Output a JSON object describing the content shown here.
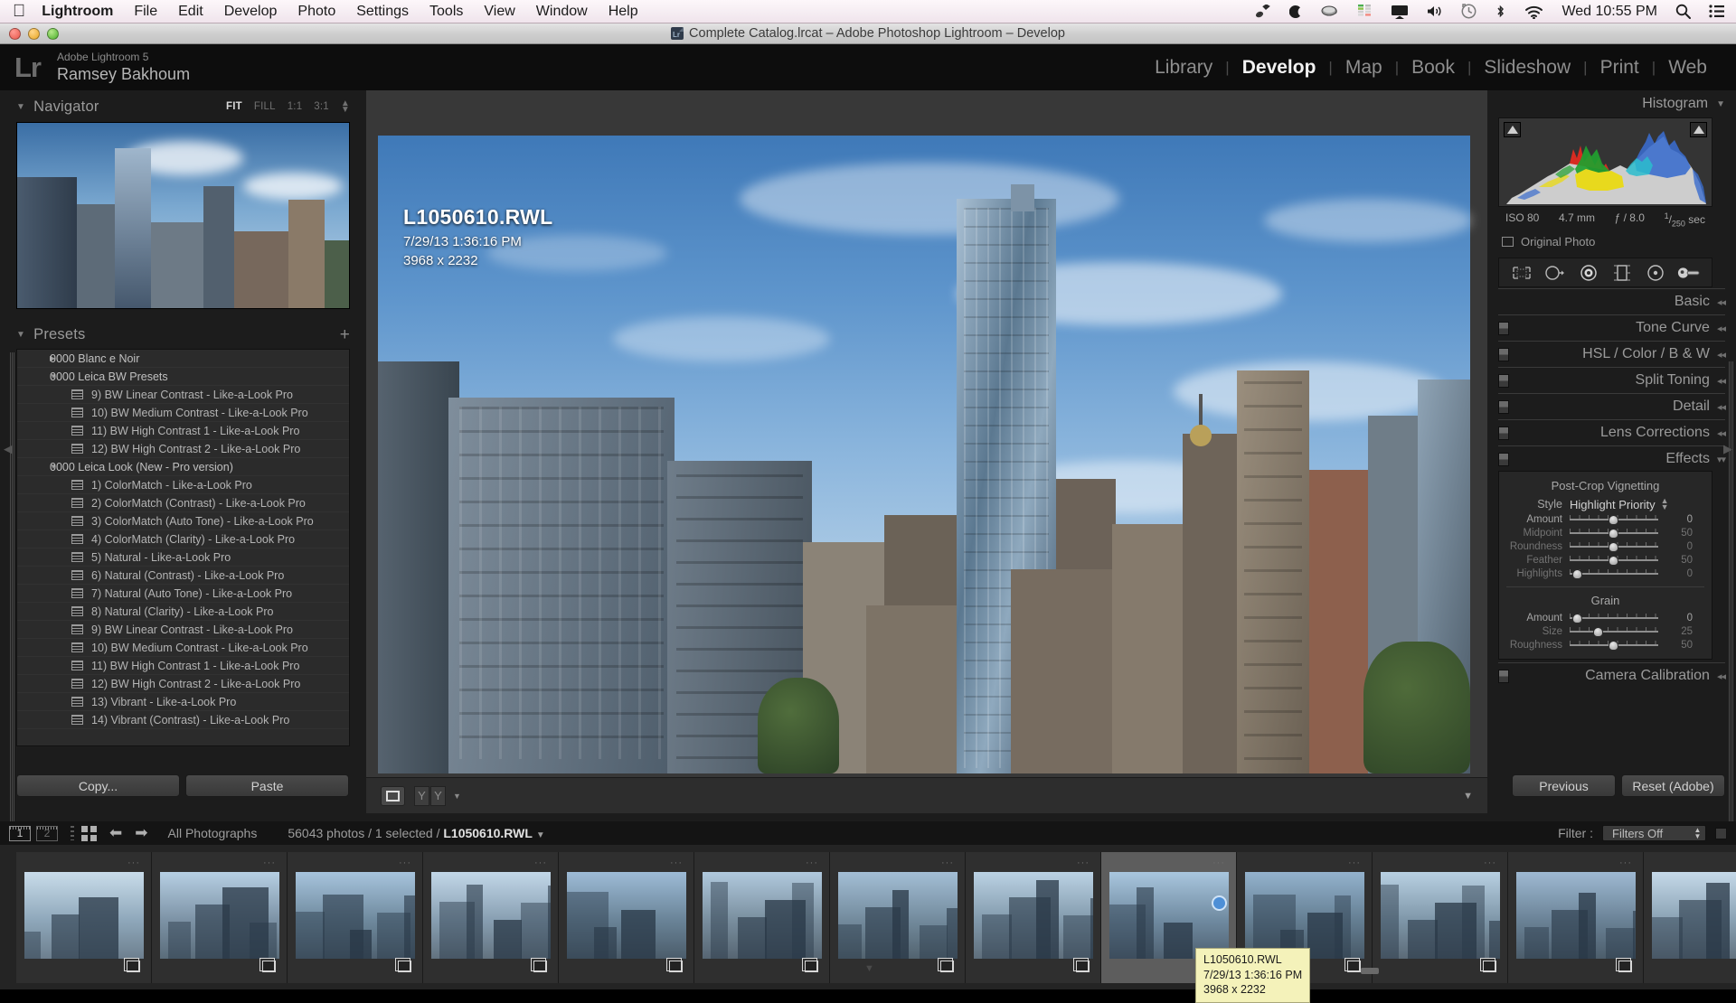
{
  "menubar": {
    "apple": "apple-logo",
    "items": [
      {
        "label": "Lightroom",
        "bold": true
      },
      {
        "label": "File",
        "bold": false
      },
      {
        "label": "Edit",
        "bold": false
      },
      {
        "label": "Develop",
        "bold": false
      },
      {
        "label": "Photo",
        "bold": false
      },
      {
        "label": "Settings",
        "bold": false
      },
      {
        "label": "Tools",
        "bold": false
      },
      {
        "label": "View",
        "bold": false
      },
      {
        "label": "Window",
        "bold": false
      },
      {
        "label": "Help",
        "bold": false
      }
    ],
    "status_icons": [
      "dropbox-icon",
      "moon-icon",
      "caffeine-cup-icon",
      "istat-menus-icon",
      "airplay-icon",
      "volume-icon",
      "time-machine-icon",
      "bluetooth-icon",
      "wifi-icon"
    ],
    "clock": "Wed 10:55 PM",
    "search_icon": "spotlight-search-icon",
    "notification_icon": "notification-center-icon"
  },
  "titlebar": {
    "title": "Complete Catalog.lrcat – Adobe Photoshop Lightroom – Develop",
    "doc_icon": "lightroom-catalog-icon"
  },
  "identity": {
    "mark": "Lr",
    "app_line": "Adobe Lightroom 5",
    "user_line": "Ramsey Bakhoum"
  },
  "modules": [
    {
      "label": "Library",
      "active": false
    },
    {
      "label": "Develop",
      "active": true
    },
    {
      "label": "Map",
      "active": false
    },
    {
      "label": "Book",
      "active": false
    },
    {
      "label": "Slideshow",
      "active": false
    },
    {
      "label": "Print",
      "active": false
    },
    {
      "label": "Web",
      "active": false
    }
  ],
  "navigator": {
    "title": "Navigator",
    "zoom_levels": [
      {
        "label": "FIT",
        "active": true
      },
      {
        "label": "FILL",
        "active": false
      },
      {
        "label": "1:1",
        "active": false
      },
      {
        "label": "3:1",
        "active": false
      }
    ],
    "stepper_icon": "zoom-stepper-icon"
  },
  "presets": {
    "title": "Presets",
    "add_icon": "plus-icon",
    "rows": [
      {
        "type": "group",
        "label": "0000 Blanc e Noir",
        "expanded": false
      },
      {
        "type": "group",
        "label": "0000 Leica BW Presets",
        "expanded": true
      },
      {
        "type": "item",
        "label": "9)  BW Linear Contrast - Like-a-Look Pro"
      },
      {
        "type": "item",
        "label": "10) BW Medium Contrast - Like-a-Look Pro"
      },
      {
        "type": "item",
        "label": "11) BW High Contrast 1 - Like-a-Look Pro"
      },
      {
        "type": "item",
        "label": "12) BW High Contrast 2 - Like-a-Look Pro"
      },
      {
        "type": "group",
        "label": "0000 Leica Look (New - Pro version)",
        "expanded": true
      },
      {
        "type": "item",
        "label": "1)  ColorMatch - Like-a-Look Pro"
      },
      {
        "type": "item",
        "label": "2)  ColorMatch (Contrast) - Like-a-Look Pro"
      },
      {
        "type": "item",
        "label": "3)  ColorMatch (Auto Tone) - Like-a-Look Pro"
      },
      {
        "type": "item",
        "label": "4)  ColorMatch (Clarity) - Like-a-Look Pro"
      },
      {
        "type": "item",
        "label": "5)  Natural - Like-a-Look Pro"
      },
      {
        "type": "item",
        "label": "6)  Natural (Contrast) - Like-a-Look Pro"
      },
      {
        "type": "item",
        "label": "7)  Natural (Auto Tone) - Like-a-Look Pro"
      },
      {
        "type": "item",
        "label": "8)  Natural (Clarity) - Like-a-Look Pro"
      },
      {
        "type": "item",
        "label": "9)  BW Linear Contrast - Like-a-Look Pro"
      },
      {
        "type": "item",
        "label": "10) BW Medium Contrast - Like-a-Look Pro"
      },
      {
        "type": "item",
        "label": "11) BW High Contrast 1 - Like-a-Look Pro"
      },
      {
        "type": "item",
        "label": "12) BW High Contrast 2 - Like-a-Look Pro"
      },
      {
        "type": "item",
        "label": "13) Vibrant - Like-a-Look Pro"
      },
      {
        "type": "item",
        "label": "14) Vibrant (Contrast) - Like-a-Look Pro"
      }
    ]
  },
  "copy_paste": {
    "copy_label": "Copy...",
    "paste_label": "Paste"
  },
  "photo_overlay": {
    "filename": "L1050610.RWL",
    "datetime": "7/29/13 1:36:16 PM",
    "dimensions": "3968 x 2232"
  },
  "toolbar": {
    "loupe_icon": "loupe-view-icon",
    "before_after_icon": "before-after-icon",
    "caret_icon": "toolbar-caret-icon",
    "hide_icon": "toolbar-collapse-icon"
  },
  "histogram": {
    "title": "Histogram",
    "collapse_icon": "panel-collapse-icon",
    "shadow_clip_icon": "shadow-clipping-icon",
    "highlight_clip_icon": "highlight-clipping-icon",
    "exif": {
      "iso": "ISO 80",
      "focal": "4.7 mm",
      "aperture": "ƒ / 8.0",
      "shutter_num": "1",
      "shutter_den": "250",
      "shutter_unit": "sec"
    },
    "original_photo_label": "Original Photo",
    "original_photo_icon": "original-photo-checkbox"
  },
  "tools": [
    {
      "name": "crop-overlay-tool"
    },
    {
      "name": "spot-removal-tool"
    },
    {
      "name": "red-eye-correction-tool"
    },
    {
      "name": "graduated-filter-tool"
    },
    {
      "name": "radial-filter-tool"
    },
    {
      "name": "adjustment-brush-tool"
    }
  ],
  "right_panels": [
    {
      "label": "Basic",
      "has_switch": false
    },
    {
      "label": "Tone Curve",
      "has_switch": true
    },
    {
      "label": "HSL / Color / B & W",
      "has_switch": true
    },
    {
      "label": "Split Toning",
      "has_switch": true
    },
    {
      "label": "Detail",
      "has_switch": true
    },
    {
      "label": "Lens Corrections",
      "has_switch": true
    },
    {
      "label": "Effects",
      "has_switch": true,
      "expanded": true
    },
    {
      "label": "Camera Calibration",
      "has_switch": true
    }
  ],
  "effects": {
    "vignetting_title": "Post-Crop Vignetting",
    "style_label": "Style",
    "style_value": "Highlight Priority",
    "vignette_sliders": [
      {
        "label": "Amount",
        "value": "0",
        "pct": 50,
        "dim": false
      },
      {
        "label": "Midpoint",
        "value": "50",
        "pct": 50,
        "dim": true
      },
      {
        "label": "Roundness",
        "value": "0",
        "pct": 50,
        "dim": true
      },
      {
        "label": "Feather",
        "value": "50",
        "pct": 50,
        "dim": true
      },
      {
        "label": "Highlights",
        "value": "0",
        "pct": 3,
        "dim": true
      }
    ],
    "grain_title": "Grain",
    "grain_sliders": [
      {
        "label": "Amount",
        "value": "0",
        "pct": 3,
        "dim": false
      },
      {
        "label": "Size",
        "value": "25",
        "pct": 30,
        "dim": true
      },
      {
        "label": "Roughness",
        "value": "50",
        "pct": 50,
        "dim": true
      }
    ]
  },
  "prev_reset": {
    "previous_label": "Previous",
    "reset_label": "Reset (Adobe)"
  },
  "filmstrip_bar": {
    "screen1": "1",
    "screen2": "2",
    "grid_icon": "grid-view-icon",
    "back_icon": "go-back-icon",
    "forward_icon": "go-forward-icon",
    "source": "All Photographs",
    "count_text": "56043 photos / 1 selected /",
    "current_file": "L1050610.RWL",
    "dropdown_icon": "source-dropdown-icon",
    "filter_label": "Filter :",
    "filter_value": "Filters Off",
    "filter_stepper_icon": "filter-stepper-icon"
  },
  "filmstrip": {
    "tooltip": {
      "filename": "L1050610.RWL",
      "datetime": "7/29/13 1:36:16 PM",
      "dimensions": "3968 x 2232"
    },
    "cells": [
      {
        "selected": false,
        "active": false
      },
      {
        "selected": false,
        "active": false
      },
      {
        "selected": false,
        "active": false
      },
      {
        "selected": false,
        "active": false
      },
      {
        "selected": false,
        "active": false
      },
      {
        "selected": false,
        "active": false
      },
      {
        "selected": false,
        "active": false
      },
      {
        "selected": false,
        "active": false
      },
      {
        "selected": true,
        "active": true
      },
      {
        "selected": false,
        "active": false
      },
      {
        "selected": false,
        "active": false
      },
      {
        "selected": false,
        "active": false
      },
      {
        "selected": false,
        "active": false
      }
    ]
  },
  "colors": {
    "panel_bg": "#1c1c1c",
    "center_bg": "#383838",
    "accent_selected": "#5d5d5d",
    "tooltip_bg": "#f4f2ba",
    "menubar_bg": "#f6eef3"
  }
}
